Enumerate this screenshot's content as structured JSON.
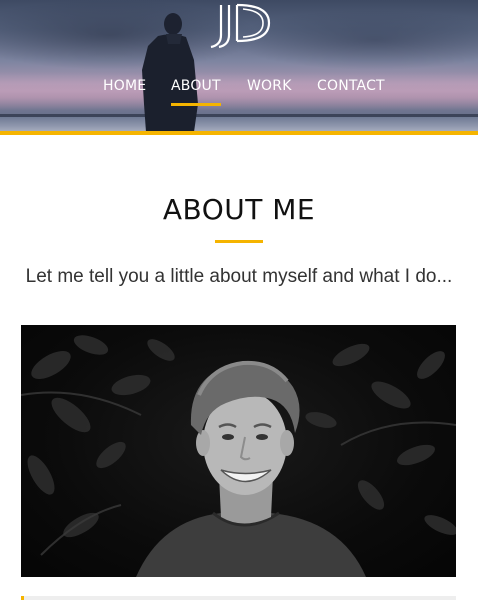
{
  "brand": {
    "logo_text": "JD"
  },
  "nav": {
    "items": [
      {
        "label": "HOME",
        "active": false
      },
      {
        "label": "ABOUT",
        "active": true
      },
      {
        "label": "WORK",
        "active": false
      },
      {
        "label": "CONTACT",
        "active": false
      }
    ]
  },
  "about": {
    "title": "ABOUT ME",
    "subtitle": "Let me tell you a little about myself and what I do..."
  },
  "progress": {
    "fraction": 0.007
  },
  "colors": {
    "accent": "#f5b400",
    "text_dark": "#111111",
    "nav_text": "#ffffff"
  },
  "icons": {
    "logo": "jd-monogram-logo",
    "hero": "person-silhouette-icon"
  }
}
